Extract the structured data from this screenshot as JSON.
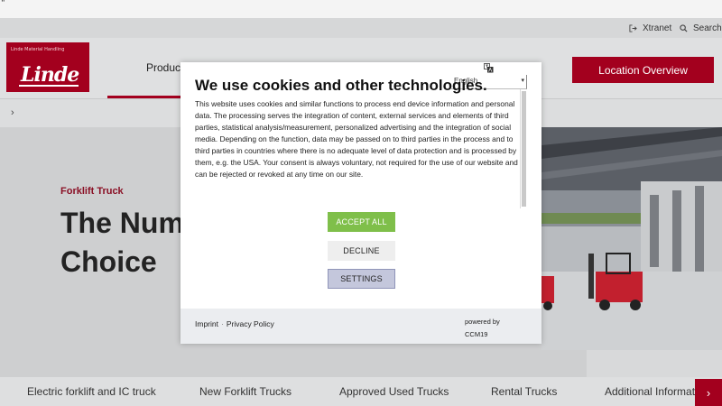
{
  "artifact": "\"",
  "util": {
    "xtranet": "Xtranet",
    "search": "Search"
  },
  "logo": {
    "small": "Linde Material Handling",
    "script": "Linde"
  },
  "nav": {
    "products": "Products",
    "location_button": "Location Overview"
  },
  "breadcrumb": {
    "chevron": "›"
  },
  "hero": {
    "kicker": "Forklift Truck",
    "title_line1": "The Num",
    "title_line2": "Choice"
  },
  "bottom_nav": {
    "items": [
      "Electric forklift and IC truck",
      "New Forklift Trucks",
      "Approved Used Trucks",
      "Rental Trucks",
      "Additional Informati"
    ],
    "next_icon": "›"
  },
  "cookie_modal": {
    "language": "English",
    "caret": "▾",
    "title": "We use cookies and other technologies.",
    "body": "This website uses cookies and similar functions to process end device information and personal data. The processing serves the integration of content, external services and elements of third parties, statistical analysis/measurement, personalized advertising and the integration of social media. Depending on the function, data may be passed on to third parties in the process and to third parties in countries where there is no adequate level of data protection and is processed by them, e.g. the USA. Your consent is always voluntary, not required for the use of our website and can be rejected or revoked at any time on our site.",
    "accept": "ACCEPT ALL",
    "decline": "DECLINE",
    "settings": "SETTINGS",
    "imprint": "Imprint",
    "separator": "·",
    "privacy": "Privacy Policy",
    "powered_by": "powered by",
    "provider": "CCM19"
  },
  "colors": {
    "brand": "#a3001e",
    "accept": "#7fbf4a",
    "settings": "#c4c7dc"
  },
  "icons": [
    "logout-icon",
    "search-icon",
    "translate-icon",
    "chevron-right-icon"
  ]
}
